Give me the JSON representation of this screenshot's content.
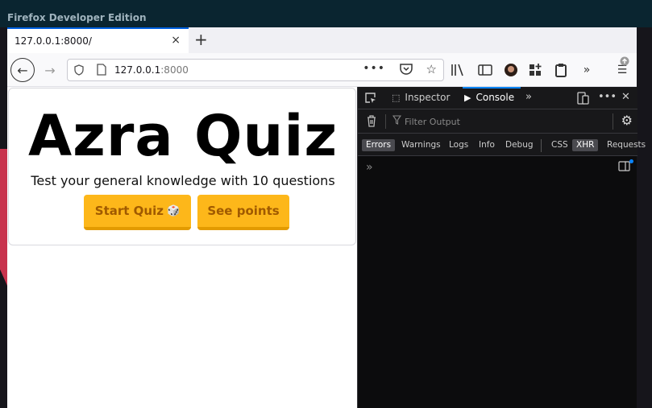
{
  "window": {
    "title": "Firefox Developer Edition"
  },
  "tab": {
    "title": "127.0.0.1:8000/",
    "close_icon": "×",
    "new_tab_icon": "+"
  },
  "navbar": {
    "url_host": "127.0.0.1",
    "url_port": ":8000",
    "back_icon": "←",
    "forward_icon": "→",
    "more_icon": "•••",
    "pocket_icon": "⛉",
    "star_icon": "☆",
    "overflow_icon": "»",
    "menu_icon": "☰"
  },
  "page": {
    "title": "Azra Quiz",
    "subtitle": "Test your general knowledge with 10 questions",
    "start_button": "Start Quiz",
    "start_button_icon": "🎲",
    "points_button": "See points"
  },
  "devtools": {
    "tabs": [
      {
        "label": "Inspector",
        "icon": "⬚"
      },
      {
        "label": "Console",
        "icon": "▶"
      }
    ],
    "overflow_icon": "»",
    "filter_placeholder": "Filter Output",
    "levels": [
      "Errors",
      "Warnings",
      "Logs",
      "Info",
      "Debug",
      "CSS",
      "XHR",
      "Requests"
    ],
    "active_levels": [
      "Errors",
      "XHR"
    ],
    "prompt": "»",
    "more_icon": "•••",
    "close_icon": "✕",
    "gear_icon": "⚙",
    "trash_icon": "🗑"
  },
  "colors": {
    "titlebar": "#0a2530",
    "button_bg": "#fdb71a",
    "button_text": "#a05a00",
    "devtools_bg": "#0c0c0d",
    "accent": "#0a84ff"
  }
}
